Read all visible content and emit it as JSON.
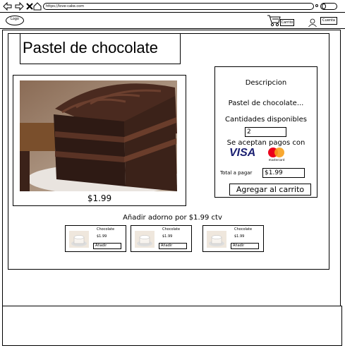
{
  "browser": {
    "url": "https://love-cake.com"
  },
  "header": {
    "logo_text": "Logo",
    "cart_label": "Carrito",
    "account_label": "Cuenta"
  },
  "product": {
    "title": "Pastel de chocolate",
    "price_label": "$1.99"
  },
  "description_panel": {
    "heading": "Descripcion",
    "name": "Pastel de chocolate...",
    "quantity_label": "Cantidades disponibles",
    "quantity_value": "2",
    "payments_label": "Se aceptan pagos con",
    "payment_methods": [
      "VISA",
      "mastercard"
    ],
    "total_label": "Total a pagar",
    "total_value": "$1.99",
    "add_to_cart_label": "Agregar al carrito"
  },
  "addons": {
    "heading": "Añadir adorno por $1.99 ctv",
    "items": [
      {
        "name": "Chocolate",
        "price": "$1.99",
        "button": "Añadir"
      },
      {
        "name": "Chocolate",
        "price": "$1.99",
        "button": "Añadir"
      },
      {
        "name": "Chocolate",
        "price": "$1.99",
        "button": "Añadir"
      }
    ]
  },
  "colors": {
    "visa": "#1a1f71",
    "mastercard_red": "#eb001b",
    "mastercard_orange": "#f79e1b",
    "cake_dark": "#3b2219",
    "cake_frosting": "#5a3325"
  }
}
